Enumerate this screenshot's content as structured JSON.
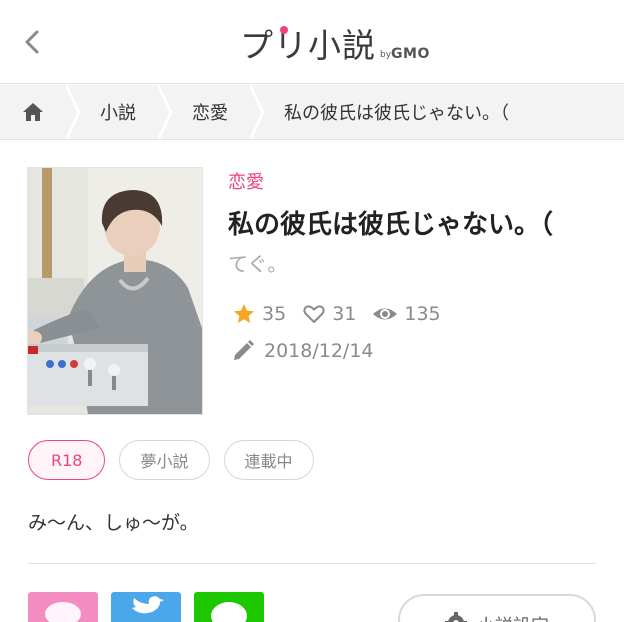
{
  "header": {
    "back_icon": "chevron-left-icon",
    "logo_text": "プリ小説",
    "logo_by": "by",
    "logo_gmo": "GMO"
  },
  "breadcrumb": {
    "home_icon": "home-icon",
    "items": [
      "小説",
      "恋愛",
      "私の彼氏は彼氏じゃない。（"
    ]
  },
  "novel": {
    "genre": "恋愛",
    "title": "私の彼氏は彼氏じゃない。（",
    "author": "てぐ。",
    "stars": "35",
    "likes": "31",
    "views": "135",
    "updated": "2018/12/14",
    "tags": [
      "R18",
      "夢小説",
      "連載中"
    ],
    "description": "み〜ん、しゅ〜が。"
  },
  "actions": {
    "share_icons": [
      "heart-bubble-icon",
      "twitter-icon",
      "line-icon"
    ],
    "settings_label": "小説設定"
  },
  "colors": {
    "accent": "#f0437a",
    "star": "#f5a623",
    "line": "#1ec800",
    "twitter": "#4aa8ea",
    "pink_share": "#f38cc0"
  }
}
